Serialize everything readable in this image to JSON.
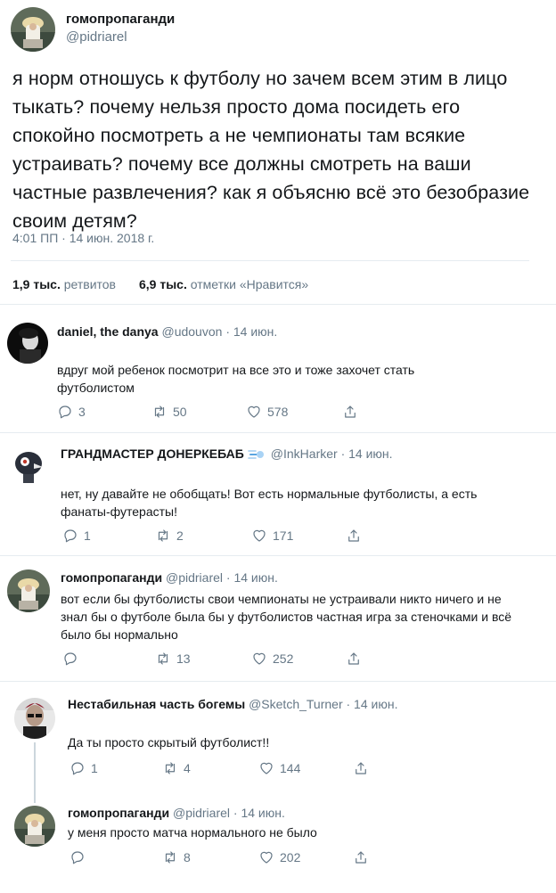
{
  "main": {
    "name": "гомопропаганди",
    "handle": "@pidriarel",
    "text": "я норм отношусь к футболу но зачем всем этим в лицо тыкать? почему нельзя просто дома посидеть его спокойно посмотреть а не чемпионаты там всякие устраивать? почему все должны смотреть на ваши частные развлечения? как я объясню всё это безобразие своим детям?",
    "timestamp": "4:01 ПП · 14 июн. 2018 г.",
    "retweets_count": "1,9 тыс.",
    "retweets_label": "ретвитов",
    "likes_count": "6,9 тыс.",
    "likes_label": "отметки «Нравится»"
  },
  "replies": [
    {
      "name": "daniel, the danya",
      "handle": "@udouvon",
      "date": "· 14 июн.",
      "text": "вдруг мой ребенок посмотрит на все это и тоже захочет стать футболистом",
      "replies": "3",
      "retweets": "50",
      "likes": "578"
    },
    {
      "name": "ГРАНДМАСТЕР ДОНЕРКЕБАБ",
      "handle": "@InkHarker",
      "date": "· 14 июн.",
      "text": "нет, ну давайте не обобщать! Вот есть нормальные футболисты, а есть фанаты-футерасты!",
      "replies": "1",
      "retweets": "2",
      "likes": "171"
    },
    {
      "name": "гомопропаганди",
      "handle": "@pidriarel",
      "date": "· 14 июн.",
      "text": "вот если бы футболисты свои чемпионаты не устраивали никто ничего и не знал бы о футболе была бы у футболистов частная игра за стеночками и всё было бы нормально",
      "replies": "",
      "retweets": "13",
      "likes": "252"
    },
    {
      "name": "Нестабильная часть богемы",
      "handle": "@Sketch_Turner",
      "date": "· 14 июн.",
      "text": "Да ты просто скрытый футболист!!",
      "replies": "1",
      "retweets": "4",
      "likes": "144"
    },
    {
      "name": "гомопропаганди",
      "handle": "@pidriarel",
      "date": "· 14 июн.",
      "text": "у меня просто матча нормального не было",
      "replies": "",
      "retweets": "8",
      "likes": "202"
    }
  ],
  "icons": {
    "reply": "reply-icon",
    "retweet": "retweet-icon",
    "like": "heart-icon",
    "share": "share-icon"
  },
  "colors": {
    "text": "#14171a",
    "secondary": "#657786",
    "divider": "#e6ecf0",
    "thread_line": "#ccd6dd"
  }
}
